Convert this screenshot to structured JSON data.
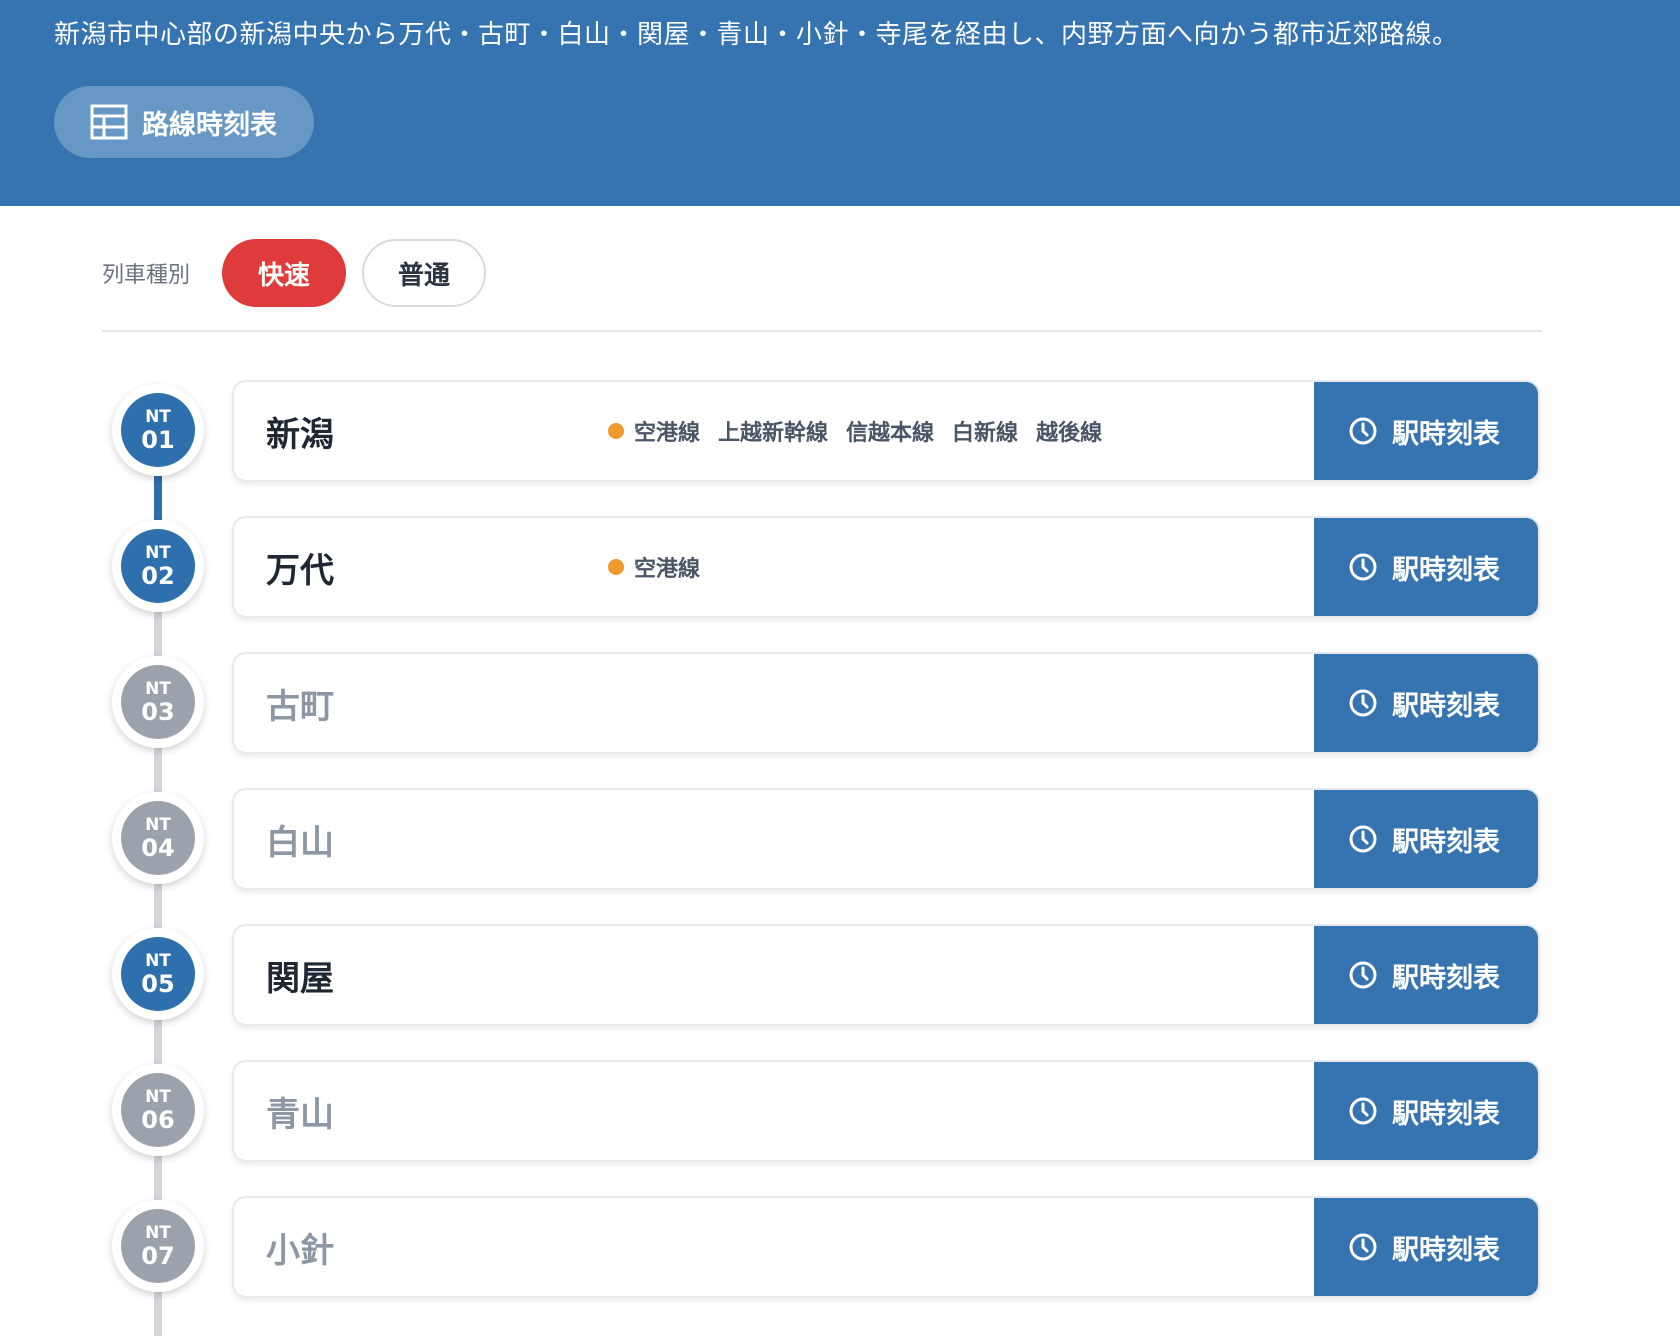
{
  "header": {
    "description": "新潟市中心部の新潟中央から万代・古町・白山・関屋・青山・小針・寺尾を経由し、内野方面へ向かう都市近郊路線。",
    "route_timetable_label": "路線時刻表",
    "route_timetable_icon": "table-icon"
  },
  "filter": {
    "label": "列車種別",
    "options": [
      {
        "label": "快速",
        "selected": true
      },
      {
        "label": "普通",
        "selected": false
      }
    ]
  },
  "colors": {
    "header_bg": "#3574b0",
    "stop_active": "#2e6fad",
    "stop_inactive": "#9ca2ab",
    "name_active": "#1f2733",
    "name_inactive": "#8c96a4",
    "rapid_chip": "#e03b3b",
    "transfer_dot": "#ef9a2a"
  },
  "stations": [
    {
      "line": "NT",
      "num": "01",
      "name": "新潟",
      "stops": true,
      "transfers": [
        "空港線",
        "上越新幹線",
        "信越本線",
        "白新線",
        "越後線"
      ],
      "timetable_label": "駅時刻表"
    },
    {
      "line": "NT",
      "num": "02",
      "name": "万代",
      "stops": true,
      "transfers": [
        "空港線"
      ],
      "timetable_label": "駅時刻表"
    },
    {
      "line": "NT",
      "num": "03",
      "name": "古町",
      "stops": false,
      "transfers": [],
      "timetable_label": "駅時刻表"
    },
    {
      "line": "NT",
      "num": "04",
      "name": "白山",
      "stops": false,
      "transfers": [],
      "timetable_label": "駅時刻表"
    },
    {
      "line": "NT",
      "num": "05",
      "name": "関屋",
      "stops": true,
      "transfers": [],
      "timetable_label": "駅時刻表"
    },
    {
      "line": "NT",
      "num": "06",
      "name": "青山",
      "stops": false,
      "transfers": [],
      "timetable_label": "駅時刻表"
    },
    {
      "line": "NT",
      "num": "07",
      "name": "小針",
      "stops": false,
      "transfers": [],
      "timetable_label": "駅時刻表"
    }
  ],
  "station_timetable_icon": "clock-icon"
}
